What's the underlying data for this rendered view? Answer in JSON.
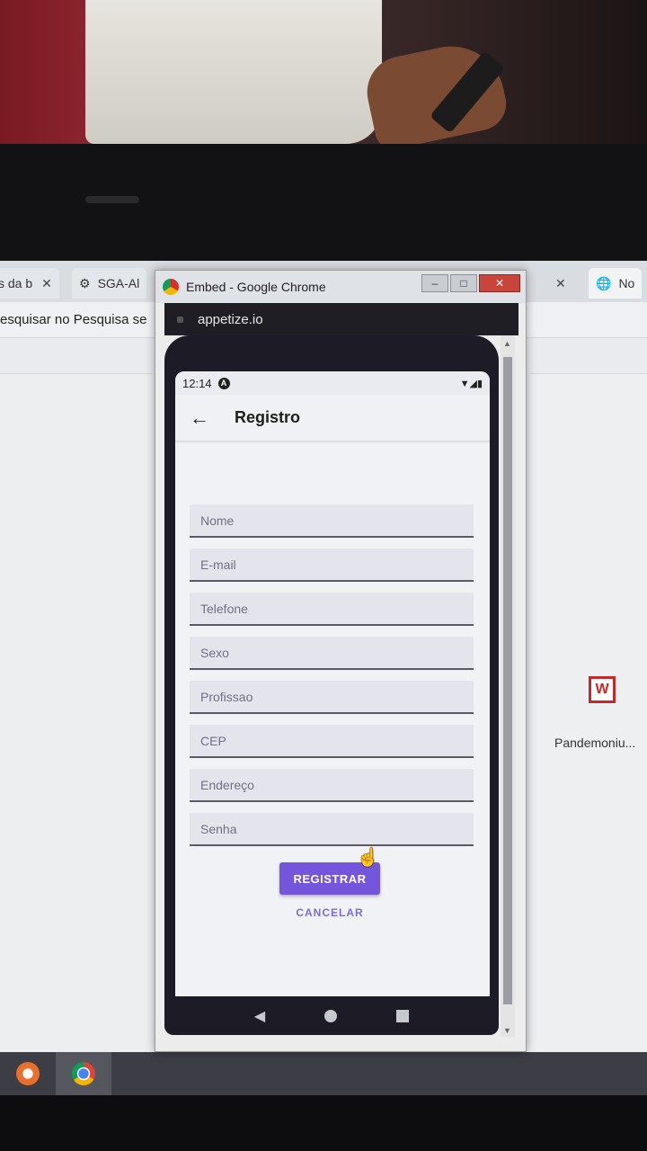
{
  "background_tabs": [
    {
      "label": "s da b",
      "close": "✕"
    },
    {
      "label": "SGA-Al",
      "close": ""
    },
    {
      "label": "",
      "close": "✕"
    },
    {
      "label": "No",
      "close": ""
    }
  ],
  "bookmark_bar": {
    "text": "esquisar no Pesquisa se"
  },
  "desktop_icon": {
    "label": "Pandemoniu..."
  },
  "embed_window": {
    "title": "Embed - Google Chrome",
    "url": "appetize.io"
  },
  "status_bar": {
    "time": "12:14",
    "notification_glyph": "A",
    "right_icons": "▼◢▮"
  },
  "app_bar": {
    "back_glyph": "←",
    "title": "Registro"
  },
  "form": {
    "fields": [
      {
        "placeholder": "Nome"
      },
      {
        "placeholder": "E-mail"
      },
      {
        "placeholder": "Telefone"
      },
      {
        "placeholder": "Sexo"
      },
      {
        "placeholder": "Profissao"
      },
      {
        "placeholder": "CEP"
      },
      {
        "placeholder": "Endereço"
      },
      {
        "placeholder": "Senha"
      }
    ],
    "register_label": "REGISTRAR",
    "cancel_label": "CANCELAR"
  },
  "nav": {
    "back": "◀"
  },
  "colors": {
    "accent": "#7456dd",
    "accent_text": "#7e6bd8",
    "field_bg": "#e4e4ec"
  }
}
